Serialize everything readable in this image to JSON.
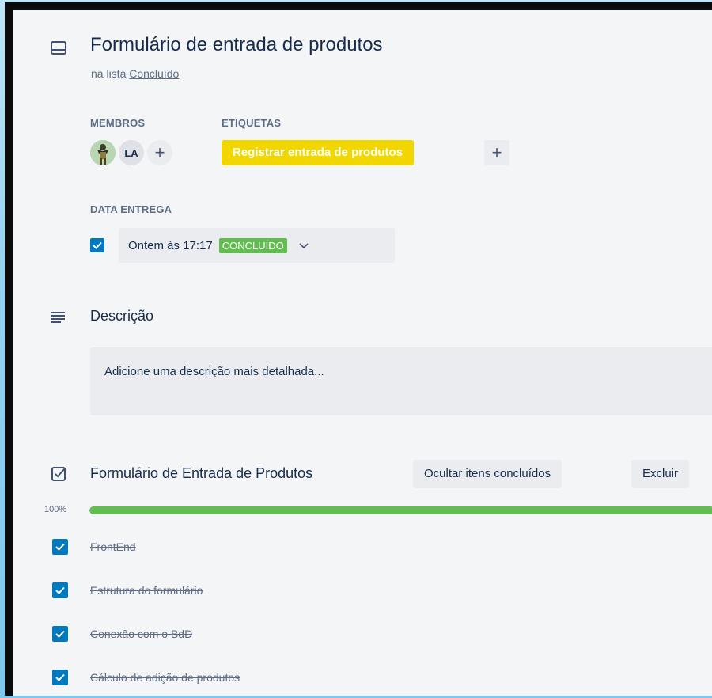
{
  "card": {
    "title": "Formulário de entrada de produtos",
    "in_list_prefix": "na lista",
    "list_name": "Concluído"
  },
  "members": {
    "label": "MEMBROS",
    "avatars": [
      {
        "type": "image",
        "name": "member-avatar-photo"
      },
      {
        "type": "initials",
        "initials": "LA"
      }
    ],
    "add_label": "+"
  },
  "labels": {
    "label": "ETIQUETAS",
    "items": [
      {
        "text": "Registrar entrada de produtos",
        "color": "#f2d600"
      }
    ],
    "add_label": "+"
  },
  "due_date": {
    "label": "DATA ENTREGA",
    "checked": true,
    "value": "Ontem às 17:17",
    "status": "CONCLUÍDO",
    "status_color": "#61bd4f"
  },
  "description": {
    "heading": "Descrição",
    "placeholder": "Adicione uma descrição mais detalhada..."
  },
  "checklist": {
    "title": "Formulário de Entrada de Produtos",
    "hide_button": "Ocultar itens concluídos",
    "delete_button": "Excluir",
    "progress_label": "100%",
    "progress_value": 1.0,
    "progress_color": "#61bd4f",
    "items": [
      {
        "text": "FrontEnd",
        "checked": true
      },
      {
        "text": "Estrutura do formulário",
        "checked": true
      },
      {
        "text": "Conexão com o BdD",
        "checked": true
      },
      {
        "text": "Cálculo de adição de produtos",
        "checked": true
      }
    ]
  }
}
